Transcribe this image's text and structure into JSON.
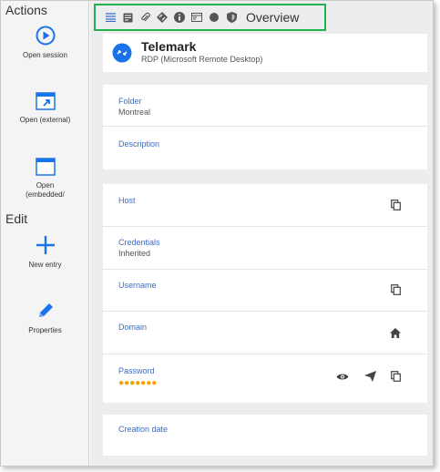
{
  "sidebar": {
    "actions_label": "Actions",
    "edit_label": "Edit",
    "items": [
      {
        "label": "Open session"
      },
      {
        "label": "Open (external)"
      },
      {
        "label": "Open\n(embedded/"
      },
      {
        "label": "New entry"
      },
      {
        "label": "Properties"
      }
    ]
  },
  "toolbar": {
    "title": "Overview",
    "icons": [
      "list-icon",
      "notes-icon",
      "attachment-icon",
      "macro-icon",
      "info-icon",
      "window-icon",
      "status-dot-icon",
      "shield-icon"
    ]
  },
  "entry": {
    "name": "Telemark",
    "type": "RDP (Microsoft Remote Desktop)"
  },
  "fields": {
    "folder_label": "Folder",
    "folder_value": "Montreal",
    "description_label": "Description",
    "host_label": "Host",
    "credentials_label": "Credentials",
    "credentials_value": "Inherited",
    "username_label": "Username",
    "domain_label": "Domain",
    "password_label": "Password",
    "password_mask": "●●●●●●●",
    "creation_date_label": "Creation date"
  },
  "colors": {
    "accent_blue": "#1a73e8",
    "label_blue": "#3a6cc5",
    "highlight_green": "#22b14c",
    "password_orange": "#f5a100"
  }
}
